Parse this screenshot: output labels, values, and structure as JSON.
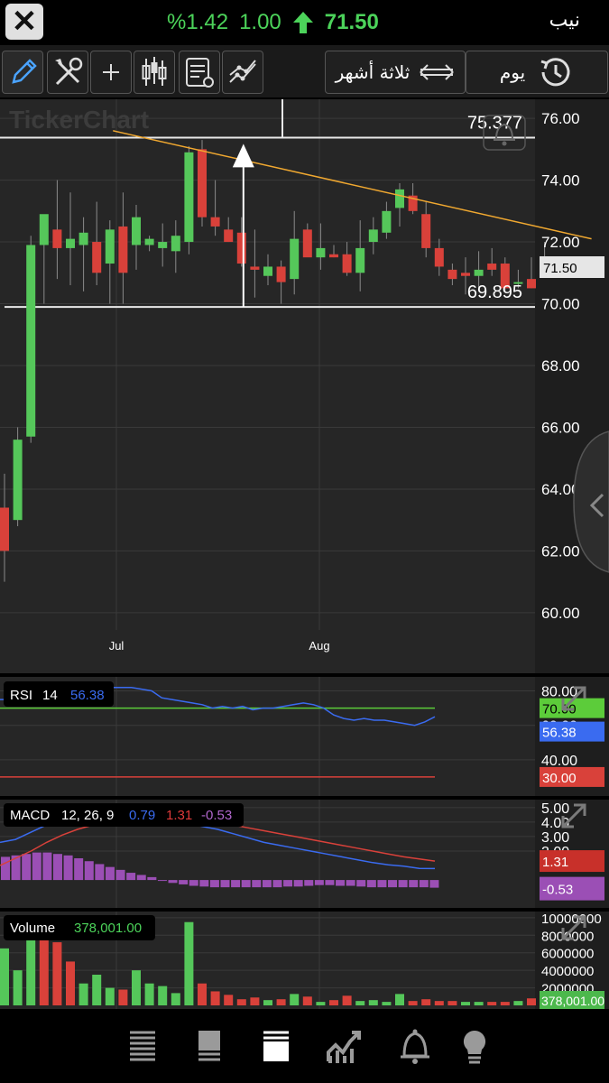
{
  "header": {
    "change_percent": "%1.42",
    "change": "1.00",
    "price": "71.50",
    "symbol": "نيب",
    "close_icon": "close-icon",
    "trend_icon": "arrow-up-icon"
  },
  "toolbar": {
    "tools": [
      "pencil-icon",
      "tools-icon",
      "crosshair-icon",
      "candlestick-icon",
      "indicator-settings-icon",
      "line-chart-icon"
    ],
    "period_label": "ثلاثة أشهر",
    "interval_label": "يوم"
  },
  "chart_data": [
    {
      "type": "candlestick",
      "watermark": "TickerChart",
      "y_ticks": [
        "76.00",
        "74.00",
        "72.00",
        "70.00",
        "68.00",
        "66.00",
        "64.00",
        "62.00",
        "60.00"
      ],
      "ylim": [
        59.5,
        76.5
      ],
      "x_ticks": [
        "Jul",
        "Aug"
      ],
      "last_price": "71.50",
      "candles": [
        {
          "o": 63.4,
          "h": 64.5,
          "l": 61.0,
          "c": 62.0
        },
        {
          "o": 63.0,
          "h": 66.0,
          "l": 62.8,
          "c": 65.6
        },
        {
          "o": 65.7,
          "h": 72.2,
          "l": 65.5,
          "c": 71.9
        },
        {
          "o": 71.9,
          "h": 72.8,
          "l": 70.0,
          "c": 72.9
        },
        {
          "o": 72.4,
          "h": 74.0,
          "l": 70.8,
          "c": 71.8
        },
        {
          "o": 71.8,
          "h": 73.6,
          "l": 70.6,
          "c": 72.1
        },
        {
          "o": 71.9,
          "h": 72.8,
          "l": 70.4,
          "c": 72.3
        },
        {
          "o": 72.0,
          "h": 73.3,
          "l": 70.6,
          "c": 71.0
        },
        {
          "o": 71.3,
          "h": 72.7,
          "l": 70.0,
          "c": 72.4
        },
        {
          "o": 72.5,
          "h": 73.6,
          "l": 70.0,
          "c": 71.0
        },
        {
          "o": 71.9,
          "h": 73.2,
          "l": 71.1,
          "c": 72.8
        },
        {
          "o": 71.9,
          "h": 72.2,
          "l": 71.7,
          "c": 72.1
        },
        {
          "o": 71.8,
          "h": 72.6,
          "l": 71.2,
          "c": 72.0
        },
        {
          "o": 71.7,
          "h": 72.7,
          "l": 71.0,
          "c": 72.2
        },
        {
          "o": 72.0,
          "h": 75.1,
          "l": 71.6,
          "c": 74.9
        },
        {
          "o": 75.0,
          "h": 75.3,
          "l": 72.5,
          "c": 72.8
        },
        {
          "o": 72.8,
          "h": 74.0,
          "l": 72.2,
          "c": 72.5
        },
        {
          "o": 72.4,
          "h": 72.8,
          "l": 72.0,
          "c": 72.0
        },
        {
          "o": 72.3,
          "h": 72.8,
          "l": 71.2,
          "c": 71.3
        },
        {
          "o": 71.2,
          "h": 72.4,
          "l": 70.2,
          "c": 71.1
        },
        {
          "o": 70.9,
          "h": 71.6,
          "l": 70.6,
          "c": 71.2
        },
        {
          "o": 71.2,
          "h": 71.4,
          "l": 70.0,
          "c": 70.7
        },
        {
          "o": 70.8,
          "h": 73.0,
          "l": 70.3,
          "c": 72.1
        },
        {
          "o": 72.4,
          "h": 72.6,
          "l": 71.6,
          "c": 71.5
        },
        {
          "o": 71.5,
          "h": 72.6,
          "l": 71.1,
          "c": 71.8
        },
        {
          "o": 71.6,
          "h": 71.9,
          "l": 71.5,
          "c": 71.5
        },
        {
          "o": 71.6,
          "h": 72.0,
          "l": 70.9,
          "c": 71.0
        },
        {
          "o": 71.0,
          "h": 72.7,
          "l": 70.4,
          "c": 71.8
        },
        {
          "o": 72.0,
          "h": 72.8,
          "l": 71.6,
          "c": 72.4
        },
        {
          "o": 72.3,
          "h": 73.3,
          "l": 72.1,
          "c": 73.0
        },
        {
          "o": 73.1,
          "h": 73.9,
          "l": 72.5,
          "c": 73.7
        },
        {
          "o": 73.5,
          "h": 73.9,
          "l": 72.9,
          "c": 73.0
        },
        {
          "o": 72.9,
          "h": 73.3,
          "l": 71.5,
          "c": 71.8
        },
        {
          "o": 71.8,
          "h": 72.1,
          "l": 70.9,
          "c": 71.2
        },
        {
          "o": 71.1,
          "h": 71.3,
          "l": 70.6,
          "c": 70.8
        },
        {
          "o": 71.0,
          "h": 71.5,
          "l": 70.3,
          "c": 70.9
        },
        {
          "o": 70.9,
          "h": 71.7,
          "l": 70.4,
          "c": 71.1
        },
        {
          "o": 71.3,
          "h": 71.8,
          "l": 70.9,
          "c": 71.1
        },
        {
          "o": 71.3,
          "h": 71.5,
          "l": 70.4,
          "c": 70.5
        },
        {
          "o": 70.7,
          "h": 71.1,
          "l": 70.5,
          "c": 70.7
        },
        {
          "o": 70.8,
          "h": 71.5,
          "l": 70.5,
          "c": 70.5
        },
        {
          "o": 71.0,
          "h": 72.0,
          "l": 70.9,
          "c": 71.5
        }
      ],
      "annotations": [
        {
          "type": "horizontal-line",
          "value": 75.377,
          "label": "75.377"
        },
        {
          "type": "horizontal-line",
          "value": 69.895,
          "label": "69.895"
        },
        {
          "type": "trendline",
          "from": {
            "index": 7,
            "value": 75.6
          },
          "to": {
            "index": 41,
            "value": 72.1
          }
        },
        {
          "type": "vertical-arrow",
          "index": 18,
          "from": 69.9,
          "to": 75.0
        }
      ],
      "alert_icon": "bell-alert-icon"
    },
    {
      "type": "line",
      "indicator": "RSI",
      "period": "14",
      "current": "56.38",
      "y_ticks": [
        "80.00",
        "60.00",
        "40.00"
      ],
      "ylim": [
        20,
        85
      ],
      "levels": [
        {
          "value": 70,
          "label": "70.00"
        },
        {
          "value": 30,
          "label": "30.00"
        }
      ],
      "values": [
        75,
        75,
        76,
        78,
        80,
        82,
        82,
        82,
        82,
        82,
        81,
        82,
        82,
        82,
        81,
        80,
        76,
        75,
        74,
        73,
        72,
        70,
        71,
        70,
        71,
        69,
        70,
        70,
        71,
        72,
        73,
        72,
        70,
        66,
        64,
        63,
        64,
        63,
        63,
        62,
        61,
        60,
        62,
        65
      ]
    },
    {
      "type": "line",
      "indicator": "MACD",
      "params": "12, 26, 9",
      "macd": "0.79",
      "signal": "1.31",
      "histogram": "-0.53",
      "y_ticks": [
        "5.00",
        "4.00",
        "3.00",
        "2.00"
      ],
      "ylim": [
        -1.8,
        5.3
      ],
      "macd_line": [
        2.6,
        2.8,
        3.3,
        3.8,
        4.2,
        4.6,
        4.8,
        4.7,
        4.5,
        4.3,
        4.2,
        4.0,
        3.9,
        3.7,
        3.5,
        3.2,
        2.9,
        2.6,
        2.4,
        2.2,
        2.0,
        1.8,
        1.6,
        1.4,
        1.2,
        1.05,
        0.95,
        0.8,
        0.79
      ],
      "signal_line": [
        1.0,
        1.5,
        2.0,
        2.6,
        3.1,
        3.5,
        3.8,
        4.1,
        4.3,
        4.4,
        4.4,
        4.3,
        4.2,
        4.1,
        4.0,
        3.8,
        3.6,
        3.4,
        3.2,
        3.0,
        2.8,
        2.6,
        2.4,
        2.2,
        2.0,
        1.8,
        1.6,
        1.45,
        1.31
      ],
      "histogram_values": [
        1.6,
        1.7,
        1.8,
        1.9,
        1.9,
        1.8,
        1.7,
        1.5,
        1.3,
        1.1,
        0.9,
        0.7,
        0.5,
        0.35,
        0.2,
        0.0,
        -0.2,
        -0.3,
        -0.4,
        -0.45,
        -0.5,
        -0.5,
        -0.5,
        -0.5,
        -0.5,
        -0.5,
        -0.5,
        -0.45,
        -0.45,
        -0.4,
        -0.35,
        -0.35,
        -0.4,
        -0.4,
        -0.45,
        -0.5,
        -0.5,
        -0.5,
        -0.5,
        -0.5,
        -0.5,
        -0.53
      ]
    },
    {
      "type": "bar",
      "indicator": "Volume",
      "current": "378,001.00",
      "y_ticks": [
        "10000000",
        "8000000",
        "6000000",
        "4000000",
        "2000000"
      ],
      "ylim": [
        0,
        10500000
      ],
      "values": [
        6500000,
        4000000,
        8000000,
        9000000,
        7200000,
        5000000,
        2500000,
        3500000,
        2000000,
        1800000,
        4000000,
        2500000,
        2200000,
        1400000,
        9500000,
        2500000,
        1600000,
        1200000,
        700000,
        900000,
        600000,
        700000,
        1300000,
        1000000,
        400000,
        600000,
        1100000,
        500000,
        600000,
        400000,
        1300000,
        500000,
        700000,
        500000,
        500000,
        400000,
        400000,
        400000,
        400000,
        500000,
        800000,
        378001
      ],
      "up_flags": [
        true,
        true,
        true,
        false,
        false,
        false,
        true,
        true,
        true,
        false,
        true,
        true,
        true,
        true,
        true,
        false,
        false,
        false,
        false,
        false,
        true,
        false,
        true,
        false,
        true,
        false,
        false,
        true,
        true,
        true,
        true,
        false,
        false,
        false,
        false,
        true,
        true,
        false,
        false,
        true,
        false,
        true
      ],
      "last_label": "378,001.00"
    }
  ],
  "bottom_nav": [
    "watchlist-icon",
    "market-depth-icon",
    "order-list-icon",
    "chart-icon",
    "alerts-icon",
    "ideas-icon"
  ]
}
